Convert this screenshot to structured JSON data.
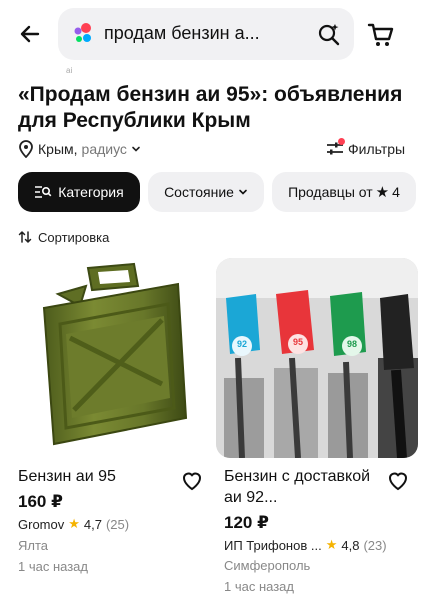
{
  "search": {
    "query": "продам бензин а...",
    "hint": "ai"
  },
  "title": "«Продам бензин аи 95»: объявления для Республики Крым",
  "location": {
    "place": "Крым,",
    "radius": "радиус"
  },
  "filters_label": "Фильтры",
  "chips": {
    "category": "Категория",
    "state": "Состояние",
    "sellers": "Продавцы от",
    "sellers_rating": "4"
  },
  "sort_label": "Сортировка",
  "colors": {
    "accent_dot": "#ff4053",
    "star": "#f5b300",
    "dark_chip": "#111111"
  },
  "listings": [
    {
      "name": "Бензин аи 95",
      "price": "160 ₽",
      "seller": "Gromov",
      "rating": "4,7",
      "reviews": "(25)",
      "city": "Ялта",
      "time": "1 час назад",
      "image": "green-jerrycan"
    },
    {
      "name": "Бензин с доставкой аи 92...",
      "price": "120 ₽",
      "seller": "ИП Трифонов ...",
      "rating": "4,8",
      "reviews": "(23)",
      "city": "Симферополь",
      "time": "1 час назад",
      "image": "fuel-pump-nozzles",
      "nozzle_labels": [
        "92",
        "95",
        "98"
      ]
    }
  ]
}
